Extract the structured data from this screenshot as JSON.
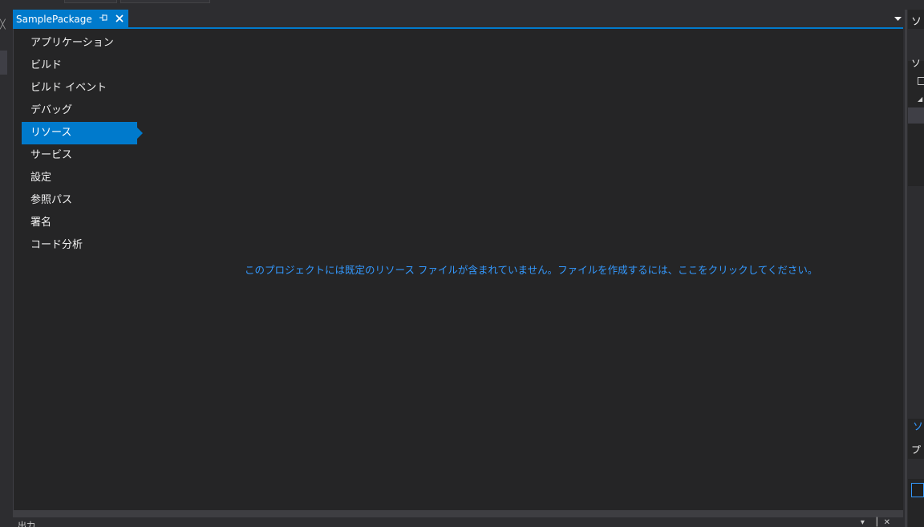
{
  "colors": {
    "accent": "#007acc",
    "link": "#3399ff",
    "background": "#252526",
    "chrome": "#2d2d30"
  },
  "tab": {
    "title": "SamplePackage",
    "pin_icon": "pin-icon",
    "close_icon": "close-icon"
  },
  "nav": {
    "items": [
      {
        "label": "アプリケーション"
      },
      {
        "label": "ビルド"
      },
      {
        "label": "ビルド イベント"
      },
      {
        "label": "デバッグ"
      },
      {
        "label": "リソース",
        "active": true
      },
      {
        "label": "サービス"
      },
      {
        "label": "設定"
      },
      {
        "label": "参照パス"
      },
      {
        "label": "署名"
      },
      {
        "label": "コード分析"
      }
    ]
  },
  "main": {
    "resource_link": "このプロジェクトには既定のリソース ファイルが含まれていません。ファイルを作成するには、ここをクリックしてください。"
  },
  "bottom_panel": {
    "title": "出力"
  },
  "right_panel": {
    "title1": "ソ",
    "title2": "ソ",
    "title3": "ソ",
    "title4": "プロ"
  }
}
